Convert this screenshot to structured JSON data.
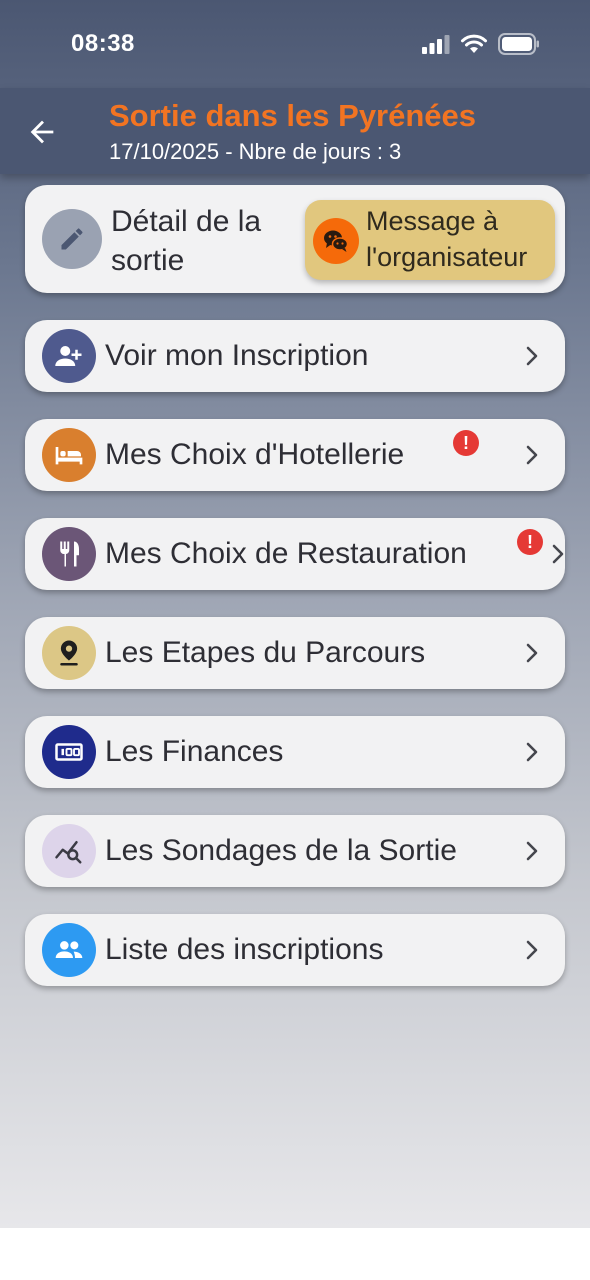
{
  "status_bar": {
    "time": "08:38"
  },
  "header": {
    "title": "Sortie dans les Pyrénées",
    "subtitle": "17/10/2025 - Nbre de jours : 3"
  },
  "detail_card": {
    "label": "Détail de la sortie",
    "message_button": "Message à l'organisateur"
  },
  "menu": [
    {
      "label": "Voir mon Inscription",
      "icon": "person-add-icon",
      "color": "#4f5a8e",
      "alert": false
    },
    {
      "label": "Mes Choix d'Hotellerie",
      "icon": "bed-icon",
      "color": "#d97f2e",
      "alert": true,
      "alert_text": "!"
    },
    {
      "label": "Mes Choix de Restauration",
      "icon": "restaurant-icon",
      "color": "#6b5677",
      "alert": true,
      "alert_text": "!"
    },
    {
      "label": "Les Etapes du Parcours",
      "icon": "location-pin-icon",
      "color": "#dcc786",
      "alert": false
    },
    {
      "label": "Les Finances",
      "icon": "money-icon",
      "color": "#1f2b8c",
      "alert": false
    },
    {
      "label": "Les Sondages de la Sortie",
      "icon": "query-stats-icon",
      "color": "#ddd4ea",
      "alert": false
    },
    {
      "label": "Liste des inscriptions",
      "icon": "group-icon",
      "color": "#2d9af2",
      "alert": false
    }
  ],
  "colors": {
    "header_bg": "#4b5772",
    "title_accent": "#f27422",
    "message_button_bg": "#e1c77e",
    "alert_red": "#e53935"
  }
}
